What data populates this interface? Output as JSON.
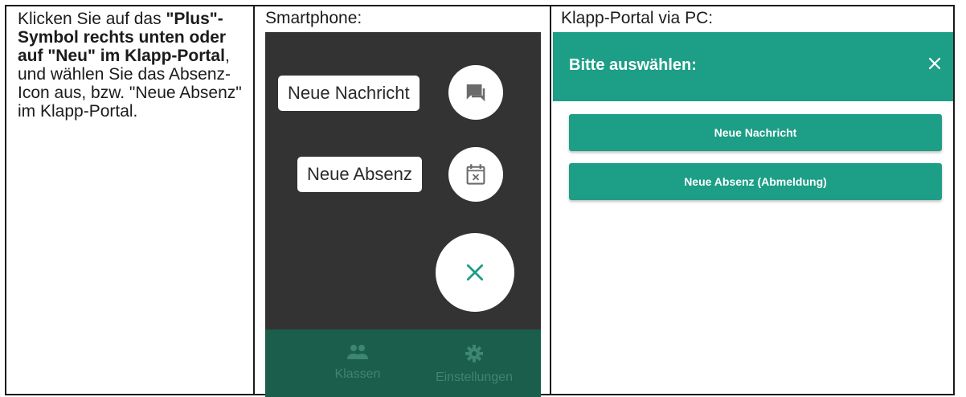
{
  "instructions": {
    "text_1": "Klicken Sie auf das ",
    "bold_1": "\"Plus\"-Symbol rechts unten oder auf \"Neu\" im Klapp-Portal",
    "text_2": ", und wählen Sie das Absenz-Icon aus, bzw. \"Neue Absenz\" im Klapp-Portal."
  },
  "smartphone": {
    "title": "Smartphone:",
    "chip_message": "Neue Nachricht",
    "chip_absence": "Neue Absenz",
    "tabs": [
      {
        "label": "Klassen",
        "icon": "people-icon"
      },
      {
        "label": "Einstellungen",
        "icon": "gear-icon"
      }
    ],
    "colors": {
      "screen": "#333333",
      "bar": "#1b5e4c",
      "accent": "#1d9e86"
    }
  },
  "portal": {
    "title": "Klapp-Portal via PC:",
    "dialog_title": "Bitte auswählen:",
    "buttons": [
      "Neue Nachricht",
      "Neue Absenz (Abmeldung)"
    ],
    "colors": {
      "accent": "#1d9e86"
    }
  }
}
